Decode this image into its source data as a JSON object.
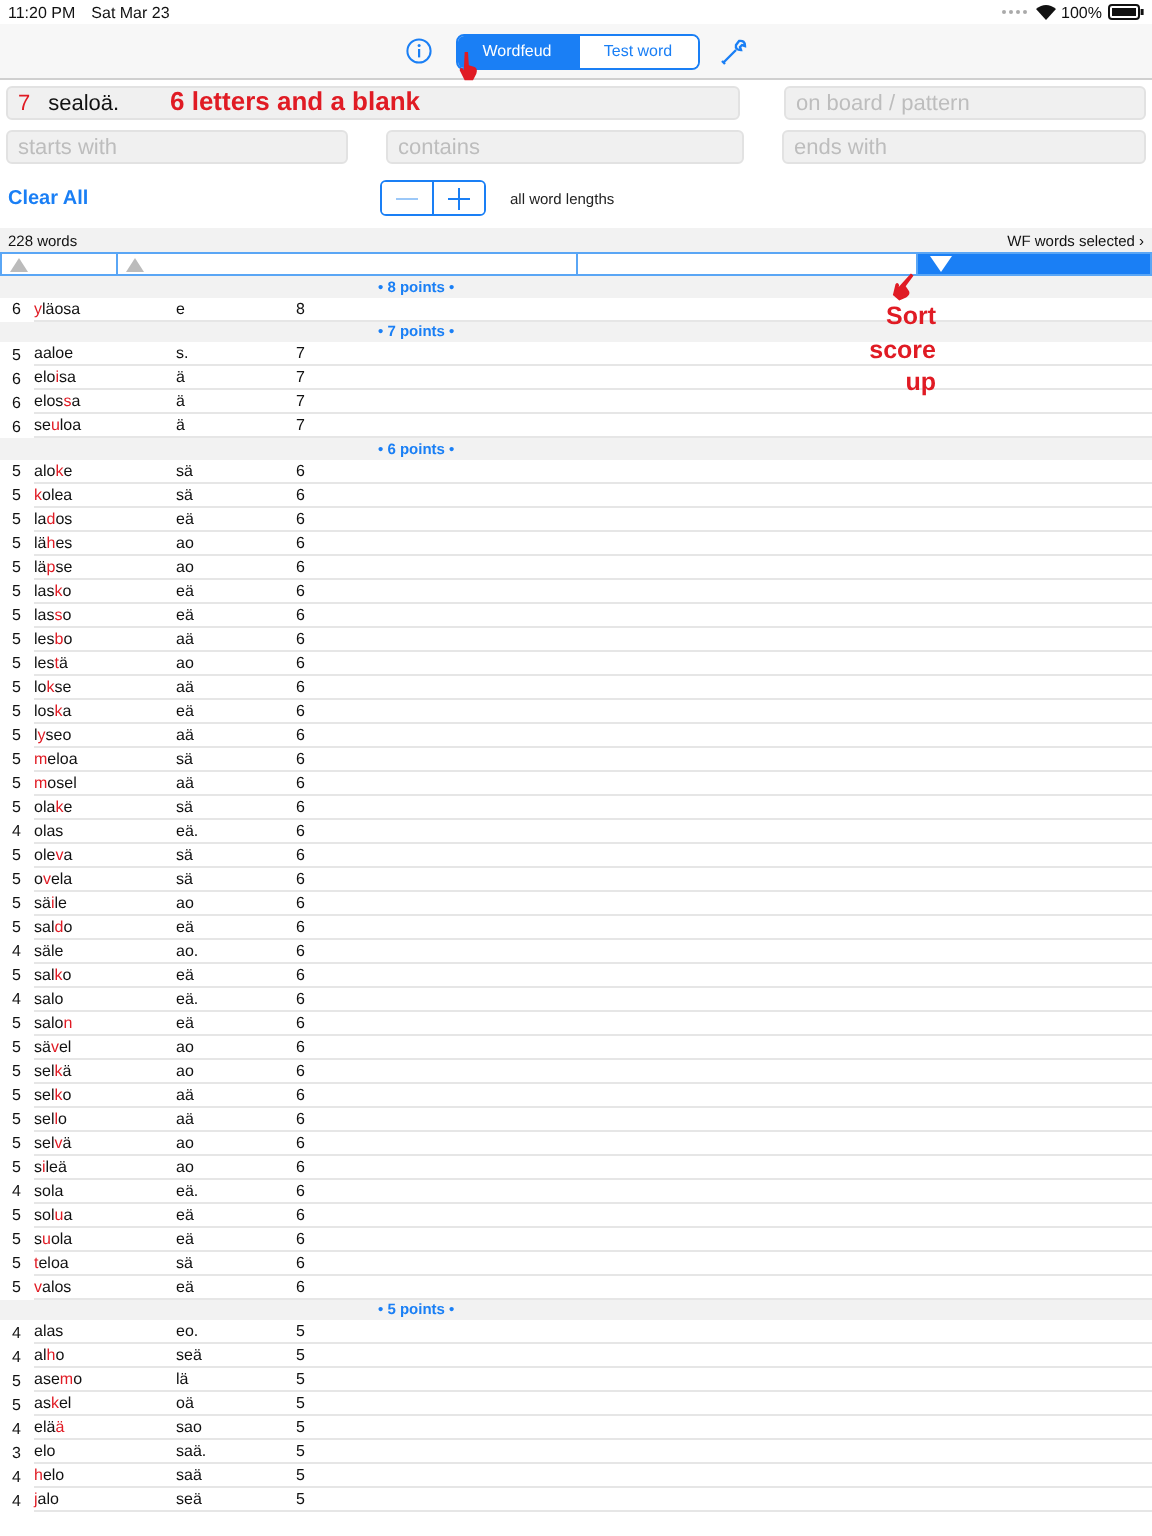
{
  "status_bar": {
    "time": "11:20 PM",
    "date": "Sat Mar 23",
    "battery": "100%"
  },
  "toolbar": {
    "segments": [
      {
        "label": "Wordfeud",
        "selected": true
      },
      {
        "label": "Test word",
        "selected": false
      }
    ]
  },
  "letters_field": {
    "count": "7",
    "value": "sealoä."
  },
  "pattern_field": {
    "placeholder": "on board / pattern"
  },
  "filters": [
    {
      "placeholder": "starts with"
    },
    {
      "placeholder": "contains"
    },
    {
      "placeholder": "ends with"
    }
  ],
  "clear_all": "Clear All",
  "length_label": "all word lengths",
  "results": {
    "count": "228 words",
    "selection": "WF words selected ›"
  },
  "sort_columns": [
    {
      "kind": "up",
      "selected": false
    },
    {
      "kind": "up",
      "selected": false
    },
    {
      "kind": "none",
      "selected": false
    },
    {
      "kind": "down",
      "selected": true
    }
  ],
  "annotations": [
    {
      "kind": "letters",
      "text": "6 letters and a blank"
    },
    {
      "kind": "sort",
      "text": "Sort score up"
    }
  ],
  "groups": [
    {
      "heading": "• 8 points •",
      "rows": [
        {
          "length": "6",
          "before": "",
          "blank": "y",
          "after": "läosa",
          "letters": "e",
          "score": "8"
        }
      ]
    },
    {
      "heading": "• 7 points •",
      "rows": [
        {
          "length": "5",
          "before": "aaloe",
          "after": "",
          "letters": "s.",
          "score": "7"
        },
        {
          "length": "6",
          "before": "elo",
          "blank": "i",
          "after": "sa",
          "letters": "ä",
          "score": "7"
        },
        {
          "length": "6",
          "before": "elos",
          "blank": "s",
          "after": "a",
          "letters": "ä",
          "score": "7"
        },
        {
          "length": "6",
          "before": "se",
          "blank": "u",
          "after": "loa",
          "letters": "ä",
          "score": "7"
        }
      ]
    },
    {
      "heading": "• 6 points •",
      "rows": [
        {
          "length": "5",
          "before": "alo",
          "blank": "k",
          "after": "e",
          "letters": "sä",
          "score": "6"
        },
        {
          "length": "5",
          "before": "",
          "blank": "k",
          "after": "olea",
          "letters": "sä",
          "score": "6"
        },
        {
          "length": "5",
          "before": "la",
          "blank": "d",
          "after": "os",
          "letters": "eä",
          "score": "6"
        },
        {
          "length": "5",
          "before": "lä",
          "blank": "h",
          "after": "es",
          "letters": "ao",
          "score": "6"
        },
        {
          "length": "5",
          "before": "lä",
          "blank": "p",
          "after": "se",
          "letters": "ao",
          "score": "6"
        },
        {
          "length": "5",
          "before": "las",
          "blank": "k",
          "after": "o",
          "letters": "eä",
          "score": "6"
        },
        {
          "length": "5",
          "before": "las",
          "blank": "s",
          "after": "o",
          "letters": "eä",
          "score": "6"
        },
        {
          "length": "5",
          "before": "les",
          "blank": "b",
          "after": "o",
          "letters": "aä",
          "score": "6"
        },
        {
          "length": "5",
          "before": "les",
          "blank": "t",
          "after": "ä",
          "letters": "ao",
          "score": "6"
        },
        {
          "length": "5",
          "before": "lo",
          "blank": "k",
          "after": "se",
          "letters": "aä",
          "score": "6"
        },
        {
          "length": "5",
          "before": "los",
          "blank": "k",
          "after": "a",
          "letters": "eä",
          "score": "6"
        },
        {
          "length": "5",
          "before": "l",
          "blank": "y",
          "after": "seo",
          "letters": "aä",
          "score": "6"
        },
        {
          "length": "5",
          "before": "",
          "blank": "m",
          "after": "eloa",
          "letters": "sä",
          "score": "6"
        },
        {
          "length": "5",
          "before": "",
          "blank": "m",
          "after": "osel",
          "letters": "aä",
          "score": "6"
        },
        {
          "length": "5",
          "before": "ola",
          "blank": "k",
          "after": "e",
          "letters": "sä",
          "score": "6"
        },
        {
          "length": "4",
          "before": "olas",
          "after": "",
          "letters": "eä.",
          "score": "6"
        },
        {
          "length": "5",
          "before": "ole",
          "blank": "v",
          "after": "a",
          "letters": "sä",
          "score": "6"
        },
        {
          "length": "5",
          "before": "o",
          "blank": "v",
          "after": "ela",
          "letters": "sä",
          "score": "6"
        },
        {
          "length": "5",
          "before": "sä",
          "blank": "i",
          "after": "le",
          "letters": "ao",
          "score": "6"
        },
        {
          "length": "5",
          "before": "sal",
          "blank": "d",
          "after": "o",
          "letters": "eä",
          "score": "6"
        },
        {
          "length": "4",
          "before": "säle",
          "after": "",
          "letters": "ao.",
          "score": "6"
        },
        {
          "length": "5",
          "before": "sal",
          "blank": "k",
          "after": "o",
          "letters": "eä",
          "score": "6"
        },
        {
          "length": "4",
          "before": "salo",
          "after": "",
          "letters": "eä.",
          "score": "6"
        },
        {
          "length": "5",
          "before": "salo",
          "blank": "n",
          "after": "",
          "letters": "eä",
          "score": "6"
        },
        {
          "length": "5",
          "before": "sä",
          "blank": "v",
          "after": "el",
          "letters": "ao",
          "score": "6"
        },
        {
          "length": "5",
          "before": "sel",
          "blank": "k",
          "after": "ä",
          "letters": "ao",
          "score": "6"
        },
        {
          "length": "5",
          "before": "sel",
          "blank": "k",
          "after": "o",
          "letters": "aä",
          "score": "6"
        },
        {
          "length": "5",
          "before": "sel",
          "blank": "l",
          "after": "o",
          "letters": "aä",
          "score": "6"
        },
        {
          "length": "5",
          "before": "sel",
          "blank": "v",
          "after": "ä",
          "letters": "ao",
          "score": "6"
        },
        {
          "length": "5",
          "before": "s",
          "blank": "i",
          "after": "leä",
          "letters": "ao",
          "score": "6"
        },
        {
          "length": "4",
          "before": "sola",
          "after": "",
          "letters": "eä.",
          "score": "6"
        },
        {
          "length": "5",
          "before": "sol",
          "blank": "u",
          "after": "a",
          "letters": "eä",
          "score": "6"
        },
        {
          "length": "5",
          "before": "s",
          "blank": "u",
          "after": "ola",
          "letters": "eä",
          "score": "6"
        },
        {
          "length": "5",
          "before": "",
          "blank": "t",
          "after": "eloa",
          "letters": "sä",
          "score": "6"
        },
        {
          "length": "5",
          "before": "",
          "blank": "v",
          "after": "alos",
          "letters": "eä",
          "score": "6"
        }
      ]
    },
    {
      "heading": "• 5 points •",
      "rows": [
        {
          "length": "4",
          "before": "alas",
          "after": "",
          "letters": "eo.",
          "score": "5"
        },
        {
          "length": "4",
          "before": "al",
          "blank": "h",
          "after": "o",
          "letters": "seä",
          "score": "5"
        },
        {
          "length": "5",
          "before": "ase",
          "blank": "m",
          "after": "o",
          "letters": "lä",
          "score": "5"
        },
        {
          "length": "5",
          "before": "as",
          "blank": "k",
          "after": "el",
          "letters": "oä",
          "score": "5"
        },
        {
          "length": "4",
          "before": "elä",
          "blank": "ä",
          "after": "",
          "letters": "sao",
          "score": "5"
        },
        {
          "length": "3",
          "before": "elo",
          "after": "",
          "letters": "saä.",
          "score": "5"
        },
        {
          "length": "4",
          "before": "",
          "blank": "h",
          "after": "elo",
          "letters": "saä",
          "score": "5"
        },
        {
          "length": "4",
          "before": "",
          "blank": "j",
          "after": "alo",
          "letters": "seä",
          "score": "5"
        }
      ]
    }
  ]
}
